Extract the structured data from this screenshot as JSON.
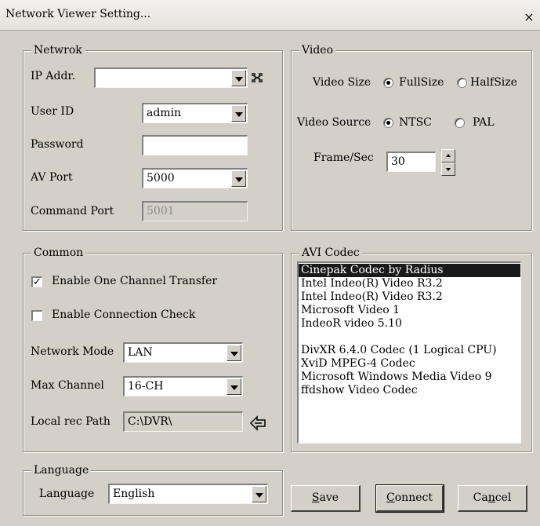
{
  "window": {
    "title": "Network Viewer Setting...",
    "close_glyph": "×"
  },
  "network": {
    "group_label": "Netwrok",
    "ip_label": "IP Addr.",
    "ip_value": "",
    "ip_icon": "network-icon",
    "user_label": "User ID",
    "user_value": "admin",
    "password_label": "Password",
    "password_value": "",
    "av_port_label": "AV Port",
    "av_port_value": "5000",
    "command_port_label": "Command Port",
    "command_port_value": "5001"
  },
  "video": {
    "group_label": "Video",
    "size_label": "Video Size",
    "size_options": [
      "FullSize",
      "HalfSize"
    ],
    "size_selected": "FullSize",
    "source_label": "Video Source",
    "source_options": [
      "NTSC",
      "PAL"
    ],
    "source_selected": "NTSC",
    "fps_label": "Frame/Sec",
    "fps_value": "30"
  },
  "common": {
    "group_label": "Common",
    "enable_one_channel_label": "Enable One Channel Transfer",
    "enable_one_channel_checked": true,
    "check_mark": "✓",
    "enable_connection_check_label": "Enable Connection Check",
    "enable_connection_check_checked": false,
    "network_mode_label": "Network Mode",
    "network_mode_value": "LAN",
    "max_channel_label": "Max Channel",
    "max_channel_value": "16-CH",
    "local_rec_label": "Local rec Path",
    "local_rec_value": "C:\\DVR\\",
    "browse_icon": "folder-arrow-icon"
  },
  "avi_codec": {
    "group_label": "AVI Codec",
    "items": [
      "Cinepak Codec by Radius",
      "Intel Indeo(R) Video R3.2",
      "Intel Indeo(R) Video R3.2",
      "Microsoft Video 1",
      "IndeoR video 5.10",
      "",
      "DivXR 6.4.0 Codec (1 Logical CPU)",
      "XviD MPEG-4 Codec",
      "Microsoft Windows Media Video 9",
      "ffdshow Video Codec"
    ],
    "selected_index": 0
  },
  "language": {
    "group_label": "Language",
    "label": "Language",
    "value": "English"
  },
  "buttons": {
    "save": {
      "hotkey": "S",
      "rest": "ave"
    },
    "connect": {
      "hotkey": "C",
      "rest": "onnect"
    },
    "cancel": {
      "pre": "Ca",
      "hotkey": "n",
      "rest": "cel"
    }
  }
}
